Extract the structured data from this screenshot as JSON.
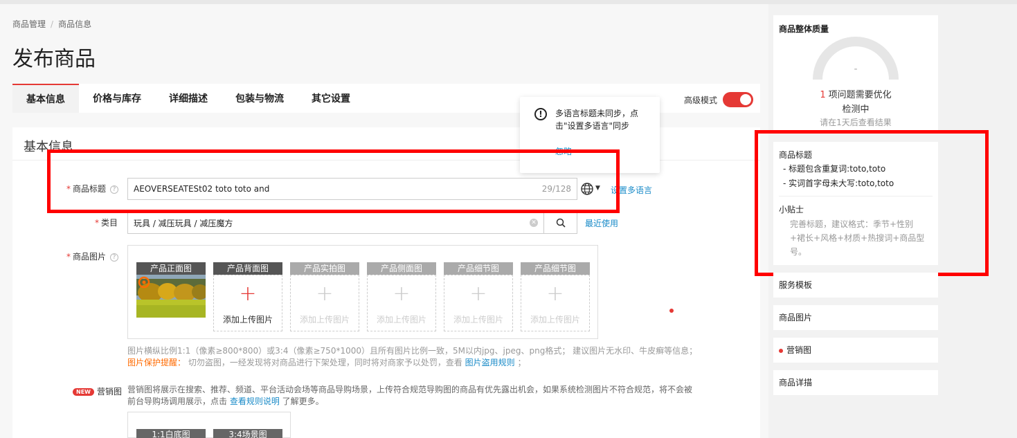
{
  "breadcrumb": {
    "root": "商品管理",
    "current": "商品信息"
  },
  "page_title": "发布商品",
  "tabs": [
    {
      "label": "基本信息"
    },
    {
      "label": "价格与库存"
    },
    {
      "label": "详细描述"
    },
    {
      "label": "包装与物流"
    },
    {
      "label": "其它设置"
    }
  ],
  "advanced_mode": {
    "label": "高级模式",
    "on": true
  },
  "section_title": "基本信息",
  "product_title": {
    "label": "商品标题",
    "value": "AEOVERSEATESt02 toto toto and",
    "count": "29/128",
    "multi_lang_link": "设置多语言",
    "globe_icon": "globe-icon"
  },
  "category": {
    "label": "类目",
    "value": "玩具 / 减压玩具 / 减压魔方",
    "recent_link": "最近使用",
    "search_icon": "search-icon"
  },
  "product_images": {
    "label": "商品图片",
    "slots": [
      {
        "caption": "产品正面图"
      },
      {
        "caption": "产品背面图",
        "add_label": "添加上传图片"
      },
      {
        "caption": "产品实拍图",
        "add_label": "添加上传图片"
      },
      {
        "caption": "产品侧面图",
        "add_label": "添加上传图片"
      },
      {
        "caption": "产品细节图",
        "add_label": "添加上传图片"
      },
      {
        "caption": "产品细节图",
        "add_label": "添加上传图片"
      }
    ],
    "note_line1": "图片横纵比例1:1（像素≥800*800）或3:4（像素≥750*1000）且所有图片比例一致，5M以内jpg、jpeg、png格式；  建议图片无水印、牛皮癣等信息；",
    "note_warn": "图片保护提醒：",
    "note_line2": "  切勿盗图，一经发现将对商品进行下架处理，同时将对商家予以处罚，查看 ",
    "note_link": "图片盗用规则",
    "note_end": " ；"
  },
  "marketing": {
    "badge": "NEW",
    "label": "营销图",
    "desc_part1": "营销图将展示在搜索、推荐、频道、平台活动会场等商品导购场景，上传符合规范导购图的商品有优先露出机会，如果系统检测图片不符合规范，将不会被前台导购场调用展示，点击 ",
    "desc_link": "查看规则说明",
    "desc_part2": " 了解更多。",
    "slots": [
      {
        "caption": "1:1白底图"
      },
      {
        "caption": "3:4场景图"
      }
    ]
  },
  "popover": {
    "message": "多语言标题未同步，点击\"设置多语言\"同步",
    "ignore": "忽略"
  },
  "quality": {
    "title": "商品整体质量",
    "score": "-",
    "issue_count": "1",
    "issue_text": "项问题需要优化",
    "status": "检测中",
    "later": "请在1天后查看结果"
  },
  "tips": {
    "heading": "商品标题",
    "line1": "- 标题包含重复词:toto,toto",
    "line2": "- 实词首字母未大写:toto,toto",
    "heading2": "小贴士",
    "body": "完善标题，建议格式：季节+性别+裙长+风格+材质+热搜词+商品型号。"
  },
  "side_nav": [
    {
      "label": "服务模板"
    },
    {
      "label": "商品图片"
    },
    {
      "label": "营销图"
    },
    {
      "label": "商品详描"
    }
  ],
  "colors": {
    "accent": "#e53935",
    "link": "#1a8bc8",
    "highlight_box": "#ff0000"
  }
}
